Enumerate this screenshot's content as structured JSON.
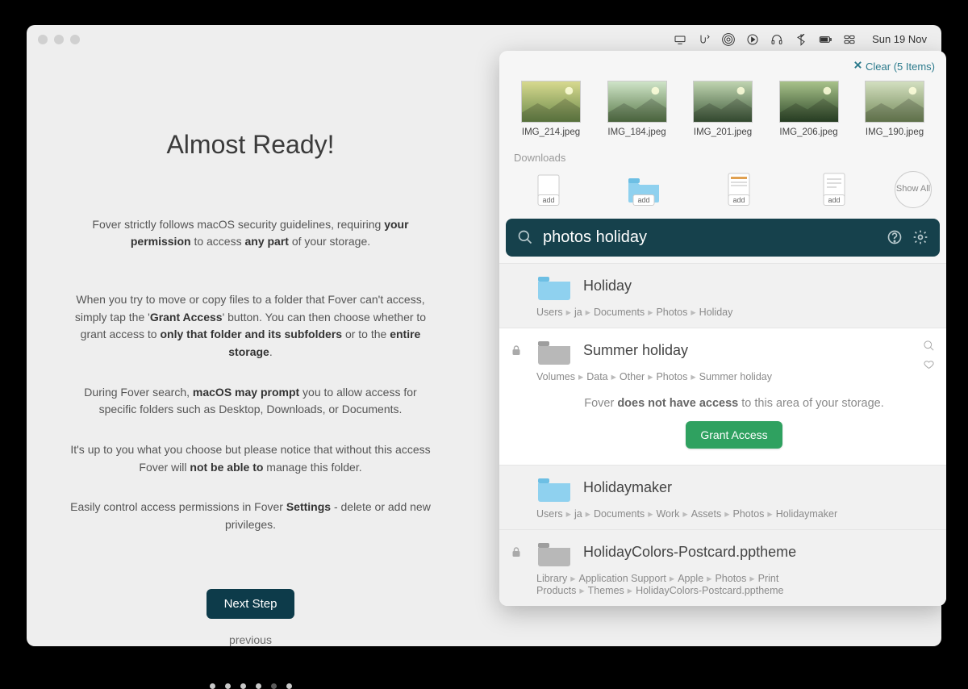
{
  "menubar": {
    "date": "Sun 19 Nov"
  },
  "onboarding": {
    "title": "Almost Ready!",
    "intro_pre": "Fover strictly follows macOS security guidelines, requiring ",
    "intro_b1": "your permission",
    "intro_mid": " to access ",
    "intro_b2": "any part",
    "intro_post": " of your storage.",
    "p2_a": "When you try to move or copy files to a folder that Fover can't access, simply tap the '",
    "p2_b1": "Grant Access",
    "p2_b": "' button. You can then choose whether to grant access to ",
    "p2_b2": "only that folder and its subfolders",
    "p2_c": " or to the ",
    "p2_b3": "entire storage",
    "p2_d": ".",
    "p3_a": "During Fover search, ",
    "p3_b1": "macOS may prompt",
    "p3_b": " you to allow access for specific folders such as Desktop, Downloads, or Documents.",
    "p4_a": "It's up to you what you choose but please notice that without this access Fover will ",
    "p4_b1": "not be able to",
    "p4_b": " manage this folder.",
    "p5_a": "Easily control access permissions in Fover ",
    "p5_b1": "Settings",
    "p5_b": " - delete or add new privileges.",
    "next": "Next Step",
    "prev": "previous",
    "dots": {
      "total": 6,
      "active": 5
    }
  },
  "popover": {
    "clear_label": "Clear (5 Items)",
    "thumbs": [
      {
        "name": "IMG_214.jpeg"
      },
      {
        "name": "IMG_184.jpeg"
      },
      {
        "name": "IMG_201.jpeg"
      },
      {
        "name": "IMG_206.jpeg"
      },
      {
        "name": "IMG_190.jpeg"
      }
    ],
    "downloads_label": "Downloads",
    "add_label": "add",
    "showall": "Show All",
    "search": "photos holiday",
    "results": [
      {
        "title": "Holiday",
        "path": [
          "Users",
          "ja",
          "Documents",
          "Photos",
          "Holiday"
        ],
        "color": "blue",
        "locked": false,
        "selected": false
      },
      {
        "title": "Summer holiday",
        "path": [
          "Volumes",
          "Data",
          "Other",
          "Photos",
          "Summer holiday"
        ],
        "color": "grey",
        "locked": true,
        "selected": true,
        "access_msg_a": "Fover ",
        "access_msg_b": "does not have access",
        "access_msg_c": " to this area of your storage.",
        "grant": "Grant Access"
      },
      {
        "title": "Holidaymaker",
        "path": [
          "Users",
          "ja",
          "Documents",
          "Work",
          "Assets",
          "Photos",
          "Holidaymaker"
        ],
        "color": "blue",
        "locked": false,
        "selected": false
      },
      {
        "title": "HolidayColors-Postcard.pptheme",
        "path": [
          "Library",
          "Application Support",
          "Apple",
          "Photos",
          "Print Products",
          "Themes",
          "HolidayColors-Postcard.pptheme"
        ],
        "color": "grey",
        "locked": true,
        "selected": false
      }
    ]
  }
}
